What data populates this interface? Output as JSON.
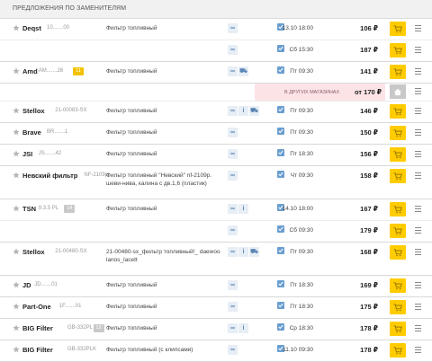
{
  "section_title": "ПРЕДЛОЖЕНИЯ ПО ЗАМЕНИТЕЛЯМ",
  "other_stores": {
    "label": "В ДРУГИХ МАГАЗИНАХ",
    "price": "от 170 ₽"
  },
  "rows": [
    {
      "kind": "main",
      "brand": "Deqst",
      "article": "10.......00",
      "desc": "Фильтр топливный",
      "icons": [
        "link"
      ],
      "date": "13.10 18:00",
      "price": "106 ₽"
    },
    {
      "kind": "sub",
      "icons": [
        "link"
      ],
      "date": "Сб 15:30",
      "price": "187 ₽"
    },
    {
      "kind": "main",
      "brand": "Amd",
      "article": "AM.......26",
      "badge": "11",
      "badge_color": "yellow",
      "desc": "Фильтр топливный",
      "icons": [
        "link",
        "car"
      ],
      "date": "Пт 09:30",
      "price": "141 ₽"
    },
    {
      "kind": "other"
    },
    {
      "kind": "main",
      "brand": "Stellox",
      "article": "21-00083-SX",
      "desc": "Фильтр топливный",
      "icons": [
        "link",
        "info",
        "car"
      ],
      "date": "Пт 09:30",
      "price": "146 ₽"
    },
    {
      "kind": "main",
      "brand": "Brave",
      "article": "BR.......1",
      "desc": "Фильтр топливный",
      "icons": [
        "link"
      ],
      "date": "Пт 09:30",
      "price": "150 ₽"
    },
    {
      "kind": "main",
      "brand": "JSI",
      "article": "JS.......42",
      "desc": "Фильтр топливный",
      "icons": [
        "link"
      ],
      "date": "Пт 18:30",
      "price": "156 ₽"
    },
    {
      "kind": "tall",
      "brand": "Невский фильтр",
      "article": "NF-2109p",
      "desc": "Фильтр топливный \"Невский\" nf-2109p. шеви-нива, калина с дв.1,6 (пластик)",
      "icons": [
        "link"
      ],
      "date": "Чт 09:30",
      "price": "158 ₽"
    },
    {
      "kind": "main",
      "brand": "TSN",
      "article": "9.3.5 PL",
      "badge": "14",
      "badge_color": "gray",
      "desc": "Фильтр топливный",
      "icons": [
        "link",
        "info"
      ],
      "date": "14.10 18:00",
      "price": "167 ₽"
    },
    {
      "kind": "sub",
      "icons": [
        "link"
      ],
      "date": "Сб 09:30",
      "price": "179 ₽"
    },
    {
      "kind": "tall",
      "brand": "Stellox",
      "article": "21-00480-SX",
      "desc": "21-00480-sx_фильтр топливный!_ daewoo lanos_lacett",
      "icons": [
        "link",
        "info",
        "car"
      ],
      "date": "Пт 09:30",
      "price": "168 ₽"
    },
    {
      "kind": "main",
      "brand": "JD",
      "article": "JD.......01",
      "desc": "Фильтр топливный",
      "icons": [
        "link"
      ],
      "date": "Пт 18:30",
      "price": "169 ₽"
    },
    {
      "kind": "main",
      "brand": "Part-One",
      "article": "1F.......01",
      "desc": "Фильтр топливный",
      "icons": [
        "link"
      ],
      "date": "Пт 18:30",
      "price": "175 ₽"
    },
    {
      "kind": "main",
      "brand": "BIG Filter",
      "article": "GB-332PL",
      "badge": "12",
      "badge_color": "gray",
      "desc": "Фильтр топливный",
      "icons": [
        "link",
        "info"
      ],
      "date": "Ср 18:30",
      "price": "178 ₽"
    },
    {
      "kind": "main",
      "brand": "BIG Filter",
      "article": "GB-332PLK",
      "desc": "Фильтр топливный (с клипсами)",
      "icons": [
        "link"
      ],
      "date": "11.10 09:30",
      "price": "178 ₽"
    }
  ]
}
